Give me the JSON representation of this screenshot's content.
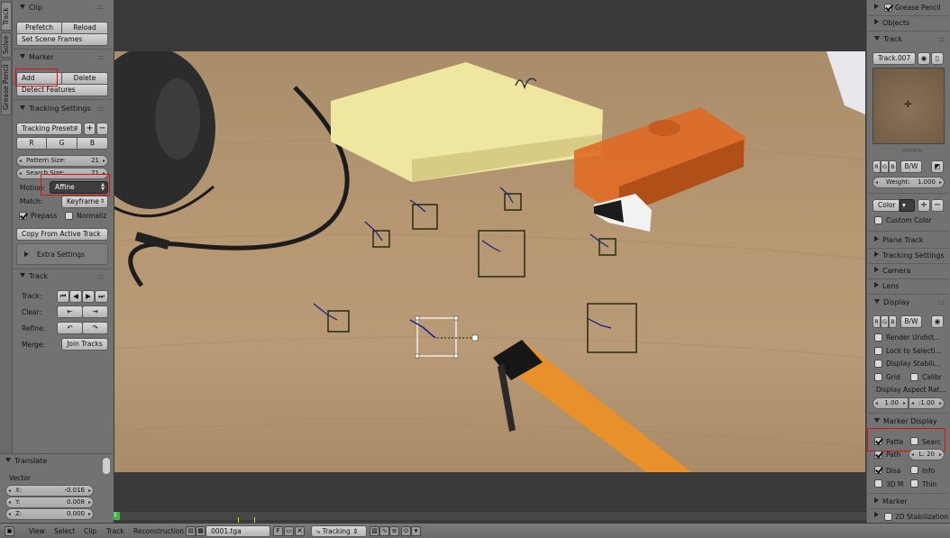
{
  "tool_tabs": [
    "Track",
    "Solve",
    "Grease Pencil"
  ],
  "clip_panel": {
    "title": "Clip",
    "prefetch": "Prefetch",
    "reload": "Reload",
    "set_scene_frames": "Set Scene Frames"
  },
  "marker_panel": {
    "title": "Marker",
    "add": "Add",
    "delete": "Delete",
    "detect_features": "Detect Features"
  },
  "tracking_settings": {
    "title": "Tracking Settings",
    "presets": "Tracking Presets",
    "channels": [
      "R",
      "G",
      "B"
    ],
    "pattern_size_label": "Pattern Size:",
    "pattern_size": "21",
    "search_size_label": "Search Size:",
    "search_size": "71",
    "motion_label": "Motion:",
    "motion_value": "Affine",
    "match_label": "Match:",
    "match_value": "Keyframe",
    "prepass": "Prepass",
    "normalize": "Normaliz",
    "copy_from_active": "Copy From Active Track",
    "extra_settings": "Extra Settings"
  },
  "track_panel": {
    "title": "Track",
    "track_label": "Track:",
    "clear_label": "Clear:",
    "refine_label": "Refine:",
    "merge_label": "Merge:",
    "join_tracks": "Join Tracks"
  },
  "operator": {
    "title": "Translate",
    "vector_label": "Vector",
    "x_label": "X:",
    "x": "-0.016",
    "y_label": "Y:",
    "y": "0.008",
    "z_label": "Z:",
    "z": "0.000"
  },
  "right": {
    "grease_pencil": "Grease Pencil",
    "objects": "Objects",
    "track": "Track",
    "track_name": "Track.007",
    "channels": [
      "R",
      "G",
      "B"
    ],
    "bw": "B/W",
    "weight_label": "Weight:",
    "weight": "1.000",
    "color": "Color",
    "custom_color": "Custom Color",
    "plane_track": "Plane Track",
    "tracking_settings": "Tracking Settings",
    "camera": "Camera",
    "lens": "Lens",
    "display": "Display",
    "render_undistorted": "Render Undist...",
    "lock_to_selection": "Lock to Selecti...",
    "display_stabilization": "Display Stabili...",
    "grid": "Grid",
    "calibration": "Calibr",
    "display_aspect_ratio": "Display Aspect Rat...",
    "aspect_x": "1.00",
    "aspect_y": ":1.00",
    "marker_display": "Marker Display",
    "pattern": "Patte",
    "search": "Searc",
    "path": "Path",
    "path_length": "L: 20",
    "disabled": "Disa",
    "info": "Info",
    "3d_markers": "3D M",
    "thin": "Thin",
    "marker": "Marker",
    "stabilization_2d": "2D Stabilization"
  },
  "footer": {
    "menus": [
      "View",
      "Select",
      "Clip",
      "Track",
      "Reconstruction"
    ],
    "clip_name": "0001.tga",
    "fake_user": "F",
    "mode": "Tracking"
  },
  "timeline": {
    "current_frame": "1"
  },
  "colors": {
    "highlight": "#e01010",
    "marker_outline": "#2a2a10",
    "path": "#1a1a8a",
    "selected": "#ffffff"
  }
}
